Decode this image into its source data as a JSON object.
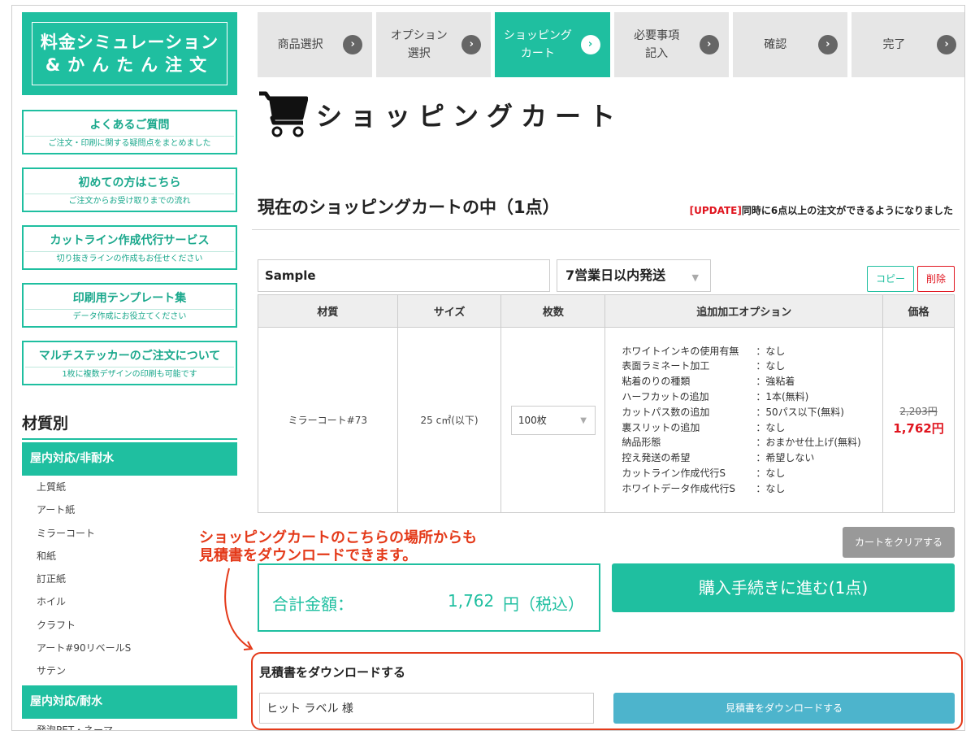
{
  "sidebar": {
    "logo_line1": "料金シミュレーション",
    "logo_line2": "&かんたん注文",
    "buttons": [
      {
        "title": "よくあるご質問",
        "sub": "ご注文・印刷に関する疑問点をまとめました"
      },
      {
        "title": "初めての方はこちら",
        "sub": "ご注文からお受け取りまでの流れ"
      },
      {
        "title": "カットライン作成代行サービス",
        "sub": "切り抜きラインの作成もお任せください"
      },
      {
        "title": "印刷用テンプレート集",
        "sub": "データ作成にお役立てください"
      },
      {
        "title": "マルチステッカーのご注文について",
        "sub": "1枚に複数デザインの印刷も可能です"
      }
    ],
    "category_heading": "材質別",
    "category1": "屋内対応/非耐水",
    "items1": [
      "上質紙",
      "アート紙",
      "ミラーコート",
      "和紙",
      "訂正紙",
      "ホイル",
      "クラフト",
      "アート#90リベールS",
      "サテン"
    ],
    "category2": "屋内対応/耐水",
    "items2": [
      "発泡PET・ネーマ"
    ]
  },
  "steps": [
    {
      "label": "商品選択",
      "arrow": "›"
    },
    {
      "label": "オプション\n選択",
      "arrow": "›"
    },
    {
      "label": "ショッピング\nカート",
      "arrow": "›"
    },
    {
      "label": "必要事項\n記入",
      "arrow": "›"
    },
    {
      "label": "確認",
      "arrow": "›"
    },
    {
      "label": "完了",
      "arrow": "›"
    }
  ],
  "active_step": 2,
  "page_title": "ショッピングカート",
  "cart_heading": "現在のショッピングカートの中（1点）",
  "update_tag": "[UPDATE]",
  "update_text": "同時に6点以上の注文ができるようになりました",
  "item": {
    "name": "Sample",
    "shipping": "7営業日以内発送",
    "copy_label": "コピー",
    "delete_label": "削除",
    "headers": [
      "材質",
      "サイズ",
      "枚数",
      "追加加工オプション",
      "価格"
    ],
    "material": "ミラーコート#73",
    "size": "25 c㎡(以下)",
    "quantity": "100枚",
    "options": [
      {
        "k": "ホワイトインキの使用有無",
        "v": "：なし"
      },
      {
        "k": "表面ラミネート加工",
        "v": "：なし"
      },
      {
        "k": "粘着のりの種類",
        "v": "：強粘着"
      },
      {
        "k": "ハーフカットの追加",
        "v": "：1本(無料)"
      },
      {
        "k": "カットパス数の追加",
        "v": "：50パス以下(無料)"
      },
      {
        "k": "裏スリットの追加",
        "v": "：なし"
      },
      {
        "k": "納品形態",
        "v": "：おまかせ仕上げ(無料)"
      },
      {
        "k": "控え発送の希望",
        "v": "：希望しない"
      },
      {
        "k": "カットライン作成代行S",
        "v": "：なし"
      },
      {
        "k": "ホワイトデータ作成代行S",
        "v": "：なし"
      }
    ],
    "price_old": "2,203円",
    "price_new": "1,762円"
  },
  "clear_cart_label": "カートをクリアする",
  "annotation_line1": "ショッピングカートのこちらの場所からも",
  "annotation_line2": "見積書をダウンロードできます。",
  "total": {
    "label": "合計金額：",
    "amount": "1,762",
    "unit": "円（税込）"
  },
  "checkout_label": "購入手続きに進む(1点)",
  "quote": {
    "title": "見積書をダウンロードする",
    "name_value": "ヒット ラベル 様",
    "button_label": "見積書をダウンロードする"
  },
  "colors": {
    "accent": "#1fbfa0",
    "danger": "#e0151f",
    "annotation": "#e43a1a",
    "quote_button": "#4db4cc"
  }
}
